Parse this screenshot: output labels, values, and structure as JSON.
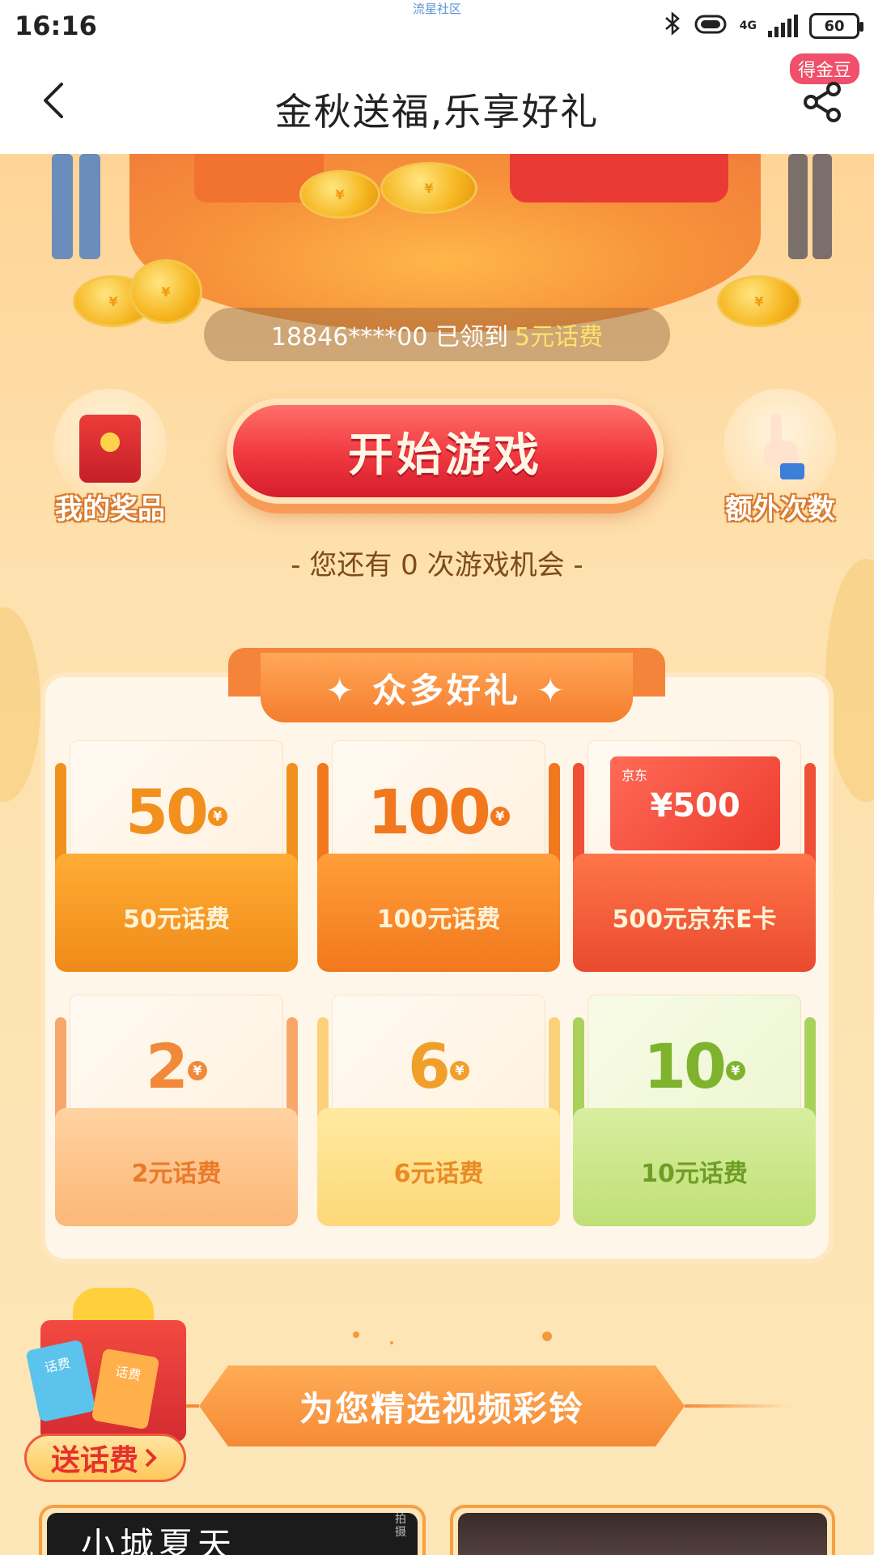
{
  "status_bar": {
    "time": "16:16",
    "carrier_center": "流星社区",
    "network": "4G",
    "battery": "60"
  },
  "nav": {
    "title": "金秋送福,乐享好礼",
    "badge": "得金豆"
  },
  "hero": {
    "ticker_prefix": "18846****00 已领到",
    "ticker_highlight": "5元话费",
    "coin_symbol": "¥"
  },
  "actions": {
    "my_prizes": "我的奖品",
    "start_game": "开始游戏",
    "extra_times": "额外次数",
    "chances_text": "- 您还有 0 次游戏机会 -"
  },
  "prize_panel": {
    "title": "✦ 众多好礼 ✦",
    "prizes": [
      {
        "amount": "50",
        "yen": "¥",
        "label": "50元话费",
        "color": "#f2901e"
      },
      {
        "amount": "100",
        "yen": "¥",
        "label": "100元话费",
        "color": "#f2781e"
      },
      {
        "card_brand": "京东",
        "card_value": "¥500",
        "label": "500元京东E卡",
        "color": "#ef4f35"
      },
      {
        "amount": "2",
        "yen": "¥",
        "label": "2元话费",
        "color": "#f08a3a"
      },
      {
        "amount": "6",
        "yen": "¥",
        "label": "6元话费",
        "color": "#f0a02a"
      },
      {
        "amount": "10",
        "yen": "¥",
        "label": "10元话费",
        "color": "#7fb32e"
      }
    ]
  },
  "video_section": {
    "title": "为您精选视频彩铃",
    "gift_cta": "送话费",
    "gift_tag_1": "话费",
    "gift_tag_2": "话费",
    "videos": [
      {
        "title": "小城夏天",
        "tag": "拍摄"
      },
      {
        "title": "",
        "tag": ""
      }
    ]
  }
}
